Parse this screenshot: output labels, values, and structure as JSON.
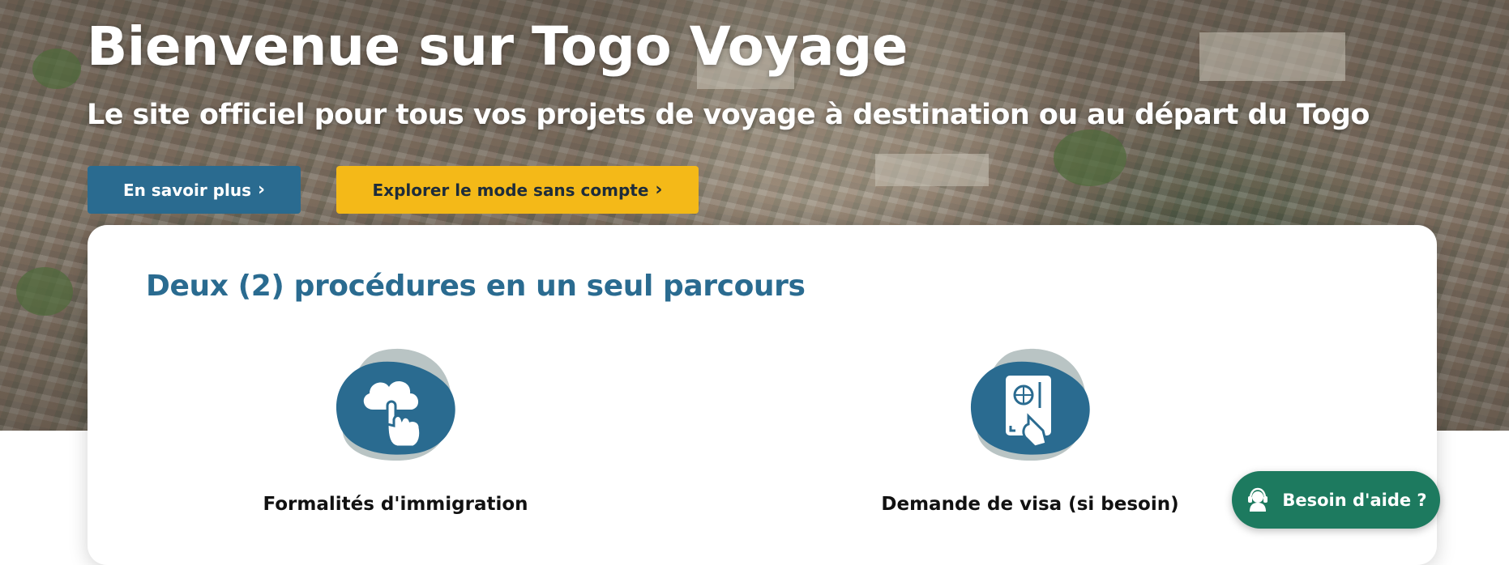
{
  "hero": {
    "title": "Bienvenue sur Togo Voyage",
    "subtitle": "Le site officiel pour tous vos projets de voyage à destination ou au départ du Togo",
    "buttons": {
      "learn_more": "En savoir plus",
      "explore_no_account": "Explorer le mode sans compte",
      "chevron": "›"
    }
  },
  "procedures": {
    "title": "Deux (2) procédures en un seul parcours",
    "items": [
      {
        "label": "Formalités d'immigration",
        "icon": "cloud-touch-icon"
      },
      {
        "label": "Demande de visa (si besoin)",
        "icon": "passport-hand-icon"
      }
    ]
  },
  "help": {
    "label": "Besoin d'aide ?",
    "icon": "support-agent-icon"
  },
  "colors": {
    "primary_blue": "#2a6b90",
    "accent_yellow": "#f4b918",
    "help_green": "#1d7a5f",
    "icon_blob_gray": "#b9c4c4"
  }
}
